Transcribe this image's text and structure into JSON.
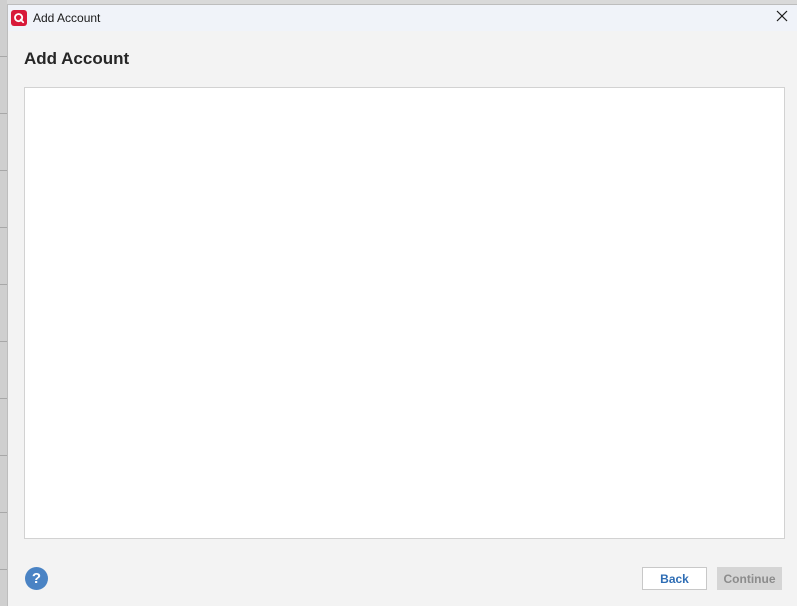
{
  "window": {
    "title": "Add Account"
  },
  "page": {
    "heading": "Add Account"
  },
  "footer": {
    "help_label": "?",
    "back_label": "Back",
    "continue_label": "Continue"
  },
  "colors": {
    "app_icon": "#d8193a",
    "help_button": "#4a83c4",
    "back_text": "#2e6db4",
    "continue_disabled": "#d5d5d5"
  },
  "icons": {
    "app": "quicken-logo-icon",
    "close": "close-icon",
    "help": "help-icon"
  }
}
